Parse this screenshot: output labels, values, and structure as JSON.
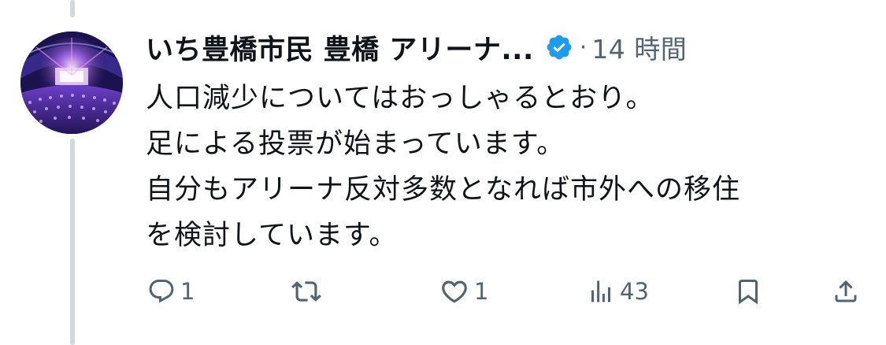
{
  "tweet": {
    "author_name": "いち豊橋市民 豊橋 アリーナ...",
    "separator": "·",
    "timestamp": "14 時間",
    "verified": true,
    "verified_color": "#1d9bf0",
    "body_lines": [
      "人口減少についてはおっしゃるとおり。",
      "足による投票が始まっています。",
      "自分もアリーナ反対多数となれば市外への移住",
      "を検討しています。"
    ]
  },
  "actions": {
    "reply": {
      "icon": "reply-icon",
      "count": "1"
    },
    "retweet": {
      "icon": "retweet-icon",
      "count": ""
    },
    "like": {
      "icon": "heart-icon",
      "count": "1"
    },
    "views": {
      "icon": "views-icon",
      "count": "43"
    },
    "bookmark": {
      "icon": "bookmark-icon"
    },
    "share": {
      "icon": "share-icon"
    }
  },
  "colors": {
    "text": "#0f1419",
    "secondary": "#536471",
    "thread_line": "#cfd9de",
    "accent": "#1d9bf0"
  }
}
